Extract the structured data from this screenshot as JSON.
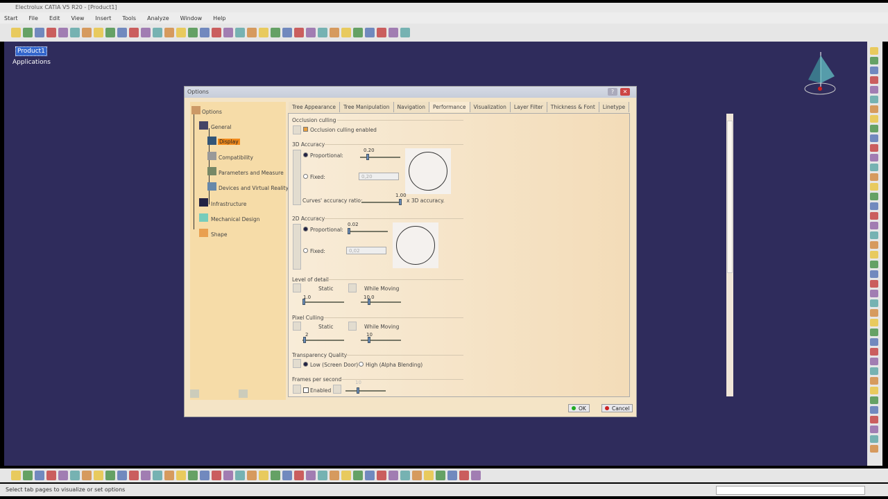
{
  "window": {
    "title": "Electrolux CATIA V5 R20 - [Product1]"
  },
  "menu": [
    "Start",
    "File",
    "Edit",
    "View",
    "Insert",
    "Tools",
    "Analyze",
    "Window",
    "Help"
  ],
  "tree": {
    "root": "Product1",
    "child": "Applications"
  },
  "status": "Select tab pages to visualize or set options",
  "dialog": {
    "title": "Options",
    "tree": [
      "Options",
      "General",
      "Display",
      "Compatibility",
      "Parameters and Measure",
      "Devices and Virtual Reality",
      "Infrastructure",
      "Mechanical Design",
      "Shape"
    ],
    "tabs": [
      "Tree Appearance",
      "Tree Manipulation",
      "Navigation",
      "Performance",
      "Visualization",
      "Layer Filter",
      "Thickness & Font",
      "Linetype"
    ],
    "active_tab": "Performance",
    "occlusion": {
      "header": "Occlusion culling",
      "label": "Occlusion culling enabled",
      "checked": true
    },
    "acc3d": {
      "header": "3D Accuracy",
      "proportional": "Proportional:",
      "prop_value": "0.20",
      "fixed": "Fixed:",
      "fixed_value": "0,20",
      "curves_label": "Curves' accuracy ratio:",
      "curves_value": "1.00",
      "curves_suffix": "x 3D accuracy."
    },
    "acc2d": {
      "header": "2D Accuracy",
      "proportional": "Proportional:",
      "prop_value": "0.02",
      "fixed": "Fixed:",
      "fixed_value": "0,02"
    },
    "lod": {
      "header": "Level of detail",
      "static": "Static",
      "moving": "While Moving",
      "static_value": "1.0",
      "moving_value": "10.0"
    },
    "pixel": {
      "header": "Pixel Culling",
      "static": "Static",
      "moving": "While Moving",
      "static_value": "2",
      "moving_value": "10"
    },
    "transp": {
      "header": "Transparency Quality",
      "low": "Low (Screen Door)",
      "high": "High (Alpha Blending)"
    },
    "fps": {
      "header": "Frames per second",
      "enabled": "Enabled",
      "value": "10"
    },
    "ok": "OK",
    "cancel": "Cancel"
  }
}
